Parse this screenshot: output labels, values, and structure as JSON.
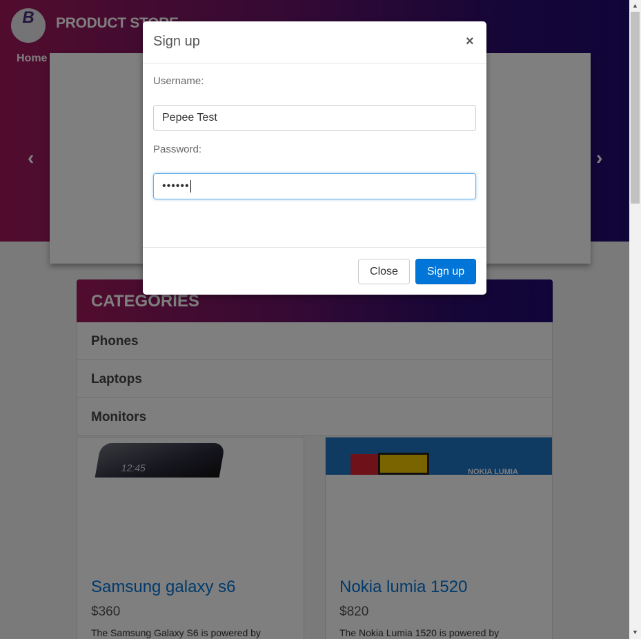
{
  "header": {
    "logo_letter": "B",
    "brand": "PRODUCT STORE",
    "nav_home": "Home",
    "prev_glyph": "‹",
    "next_glyph": "›"
  },
  "categories": {
    "title": "CATEGORIES",
    "items": [
      {
        "label": "Phones"
      },
      {
        "label": "Laptops"
      },
      {
        "label": "Monitors"
      }
    ]
  },
  "products": [
    {
      "title": "Samsung galaxy s6",
      "price": "$360",
      "description": "The Samsung Galaxy S6 is powered by",
      "image_text": "12:45"
    },
    {
      "title": "Nokia lumia 1520",
      "price": "$820",
      "description": "The Nokia Lumia 1520 is powered by",
      "image_text": "NOKIA LUMIA"
    }
  ],
  "modal": {
    "title": "Sign up",
    "close_x": "×",
    "username_label": "Username:",
    "username_value": "Pepee Test",
    "password_label": "Password:",
    "password_mask": "••••••",
    "close_button": "Close",
    "signup_button": "Sign up"
  },
  "scrollbar": {
    "up": "▲",
    "down": "▼"
  },
  "colors": {
    "gradient_start": "#a3195b",
    "gradient_end": "#210a72",
    "primary": "#0275d8",
    "focus": "#66afe9"
  }
}
